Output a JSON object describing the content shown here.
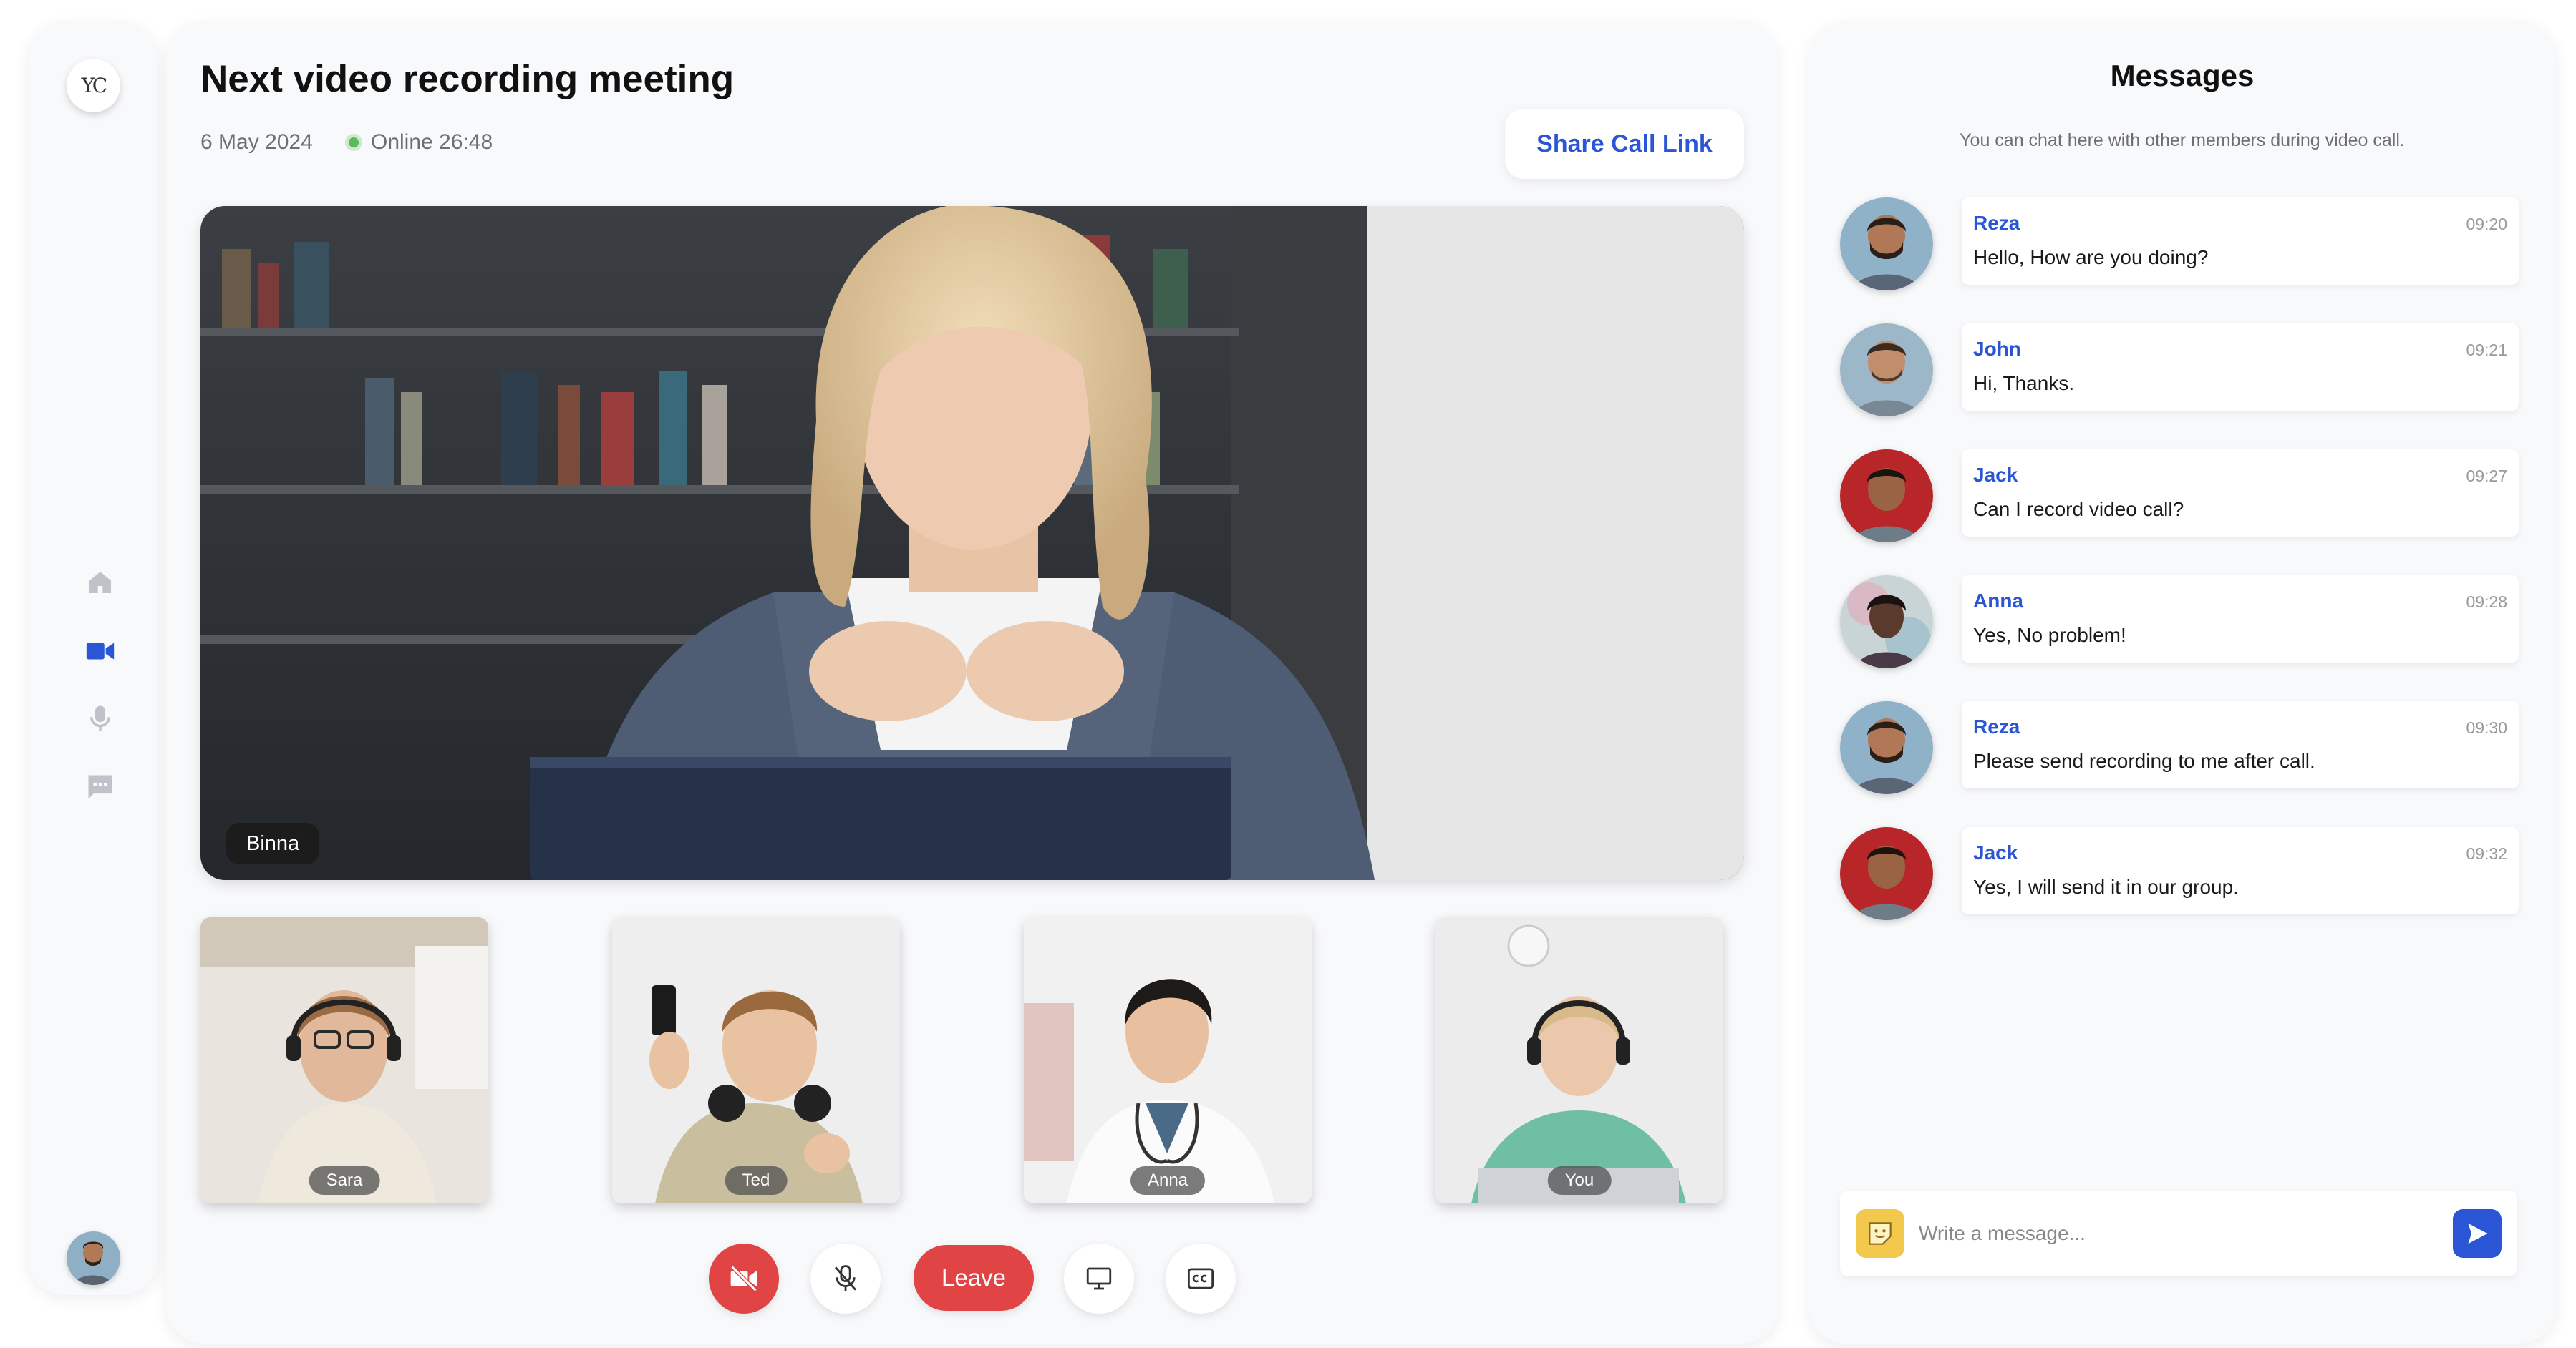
{
  "app": {
    "logo_text": "YC"
  },
  "sidebar": {
    "items": [
      {
        "icon": "home-icon",
        "active": false
      },
      {
        "icon": "video-camera-icon",
        "active": true
      },
      {
        "icon": "microphone-icon",
        "active": false
      },
      {
        "icon": "chat-icon",
        "active": false
      }
    ],
    "user_avatar": "user-avatar"
  },
  "meeting": {
    "title": "Next video recording meeting",
    "date": "6 May 2024",
    "status": "Online 26:48",
    "share_label": "Share Call Link",
    "main_speaker": "Binna",
    "participants": [
      "Sara",
      "Ted",
      "Anna",
      "You"
    ]
  },
  "controls": {
    "leave_label": "Leave",
    "buttons": [
      "camera-off-icon",
      "mic-off-icon",
      "screen-share-icon",
      "captions-icon"
    ]
  },
  "chat": {
    "title": "Messages",
    "subtitle": "You can chat here with other members during video call.",
    "messages": [
      {
        "name": "Reza",
        "time": "09:20",
        "text": "Hello, How are you doing?"
      },
      {
        "name": "John",
        "time": "09:21",
        "text": "Hi, Thanks."
      },
      {
        "name": "Jack",
        "time": "09:27",
        "text": "Can I record video call?"
      },
      {
        "name": "Anna",
        "time": "09:28",
        "text": "Yes, No problem!"
      },
      {
        "name": "Reza",
        "time": "09:30",
        "text": "Please send recording to me after call."
      },
      {
        "name": "Jack",
        "time": "09:32",
        "text": "Yes, I will send it in our group."
      }
    ],
    "input_placeholder": "Write a message..."
  },
  "colors": {
    "accent": "#2a56d6",
    "danger": "#e04444",
    "online": "#5cb85c",
    "inactive_icon": "#bfc3c9"
  }
}
